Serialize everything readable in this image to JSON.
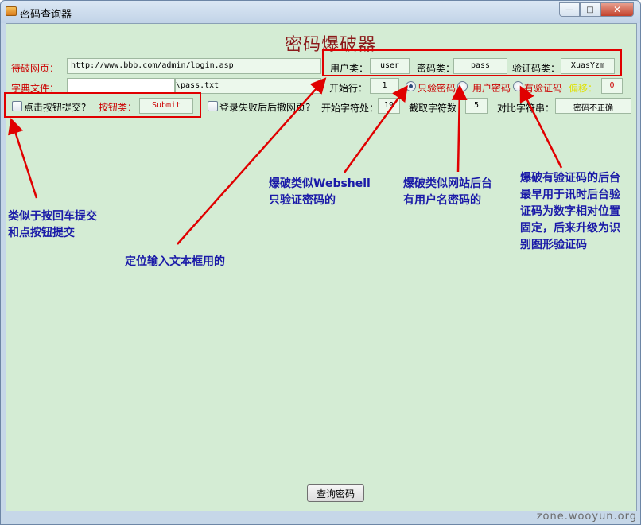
{
  "window": {
    "title": "密码查询器",
    "minimize_glyph": "—",
    "maximize_glyph": "□",
    "close_glyph": "✕"
  },
  "heading": "密码爆破器",
  "form": {
    "target_url_label": "待破网页：",
    "target_url_value": "http://www.bbb.com/admin/login.asp",
    "dict_label": "字典文件：",
    "dict_value": "\\pass.txt",
    "user_type_label": "用户类：",
    "user_type_value": "user",
    "pass_type_label": "密码类：",
    "pass_type_value": "pass",
    "captcha_type_label": "验证码类：",
    "captcha_type_value": "XuasYzm",
    "start_line_label": "开始行：",
    "start_line_value": "1",
    "radio_pass_only": "只验密码",
    "radio_user_pass": "用户密码",
    "radio_captcha": "有验证码",
    "offset_label": "偏移：",
    "offset_value": "0",
    "click_submit_label": "点击按钮提交?",
    "button_type_label": "按钮类：",
    "button_type_value": "Submit",
    "back_label": "登录失败后后撤网页?",
    "start_char_label": "开始字符处：",
    "start_char_value": "19",
    "cut_chars_label": "截取字符数",
    "cut_chars_value": "5",
    "compare_label": "对比字符串：",
    "compare_value": "密码不正确",
    "selected_radio": "只验密码"
  },
  "annotations": {
    "enter_submit": [
      "类似于按回车提交",
      "和点按钮提交"
    ],
    "locate_input": "定位输入文本框用的",
    "webshell": [
      "爆破类似Webshell",
      "只验证密码的"
    ],
    "site_backend": [
      "爆破类似网站后台",
      "有用户名密码的"
    ],
    "captcha_backend": [
      "爆破有验证码的后台",
      "最早用于讯时后台验",
      "证码为数字相对位置",
      "固定，后来升级为识",
      "别图形验证码"
    ]
  },
  "query_button": "查询密码",
  "watermark": "zone.wooyun.org",
  "colors": {
    "client_bg": "#d4ecd4",
    "label_red": "#cc0000",
    "annotation_blue": "#1a1aa8",
    "arrow_red": "#e00000"
  }
}
